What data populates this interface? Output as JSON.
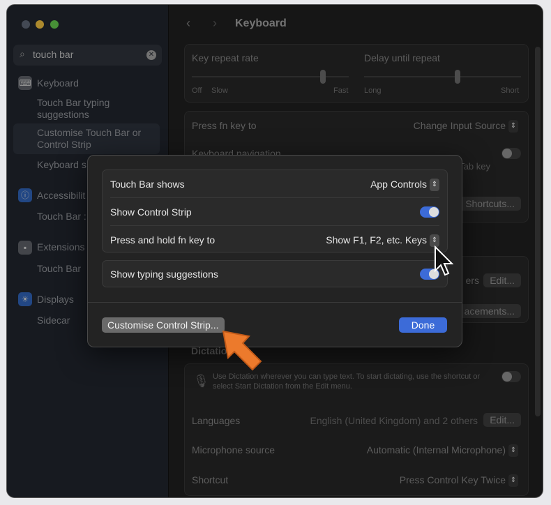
{
  "sidebar": {
    "search_value": "touch bar",
    "groups": [
      {
        "label": "Keyboard",
        "items": [
          "Touch Bar typing suggestions",
          "Customise Touch Bar or Control Strip",
          "Keyboard s"
        ]
      },
      {
        "label": "Accessibilit",
        "items": [
          "Touch Bar :"
        ]
      },
      {
        "label": "Extensions",
        "items": [
          "Touch Bar"
        ]
      },
      {
        "label": "Displays",
        "items": [
          "Sidecar"
        ]
      }
    ]
  },
  "header": {
    "title": "Keyboard"
  },
  "main": {
    "key_repeat": {
      "label": "Key repeat rate",
      "min": "Off",
      "min2": "Slow",
      "max": "Fast",
      "value_fraction": 0.85
    },
    "delay_repeat": {
      "label": "Delay until repeat",
      "min": "Long",
      "max": "Short",
      "value_fraction": 0.6
    },
    "fn_key": {
      "label": "Press fn key to",
      "value": "Change Input Source"
    },
    "keyboard_nav": {
      "label": "Keyboard navigation",
      "hint": "Tab key"
    },
    "shortcuts_btn": "Shortcuts...",
    "edit_btn": "Edit...",
    "edit_hint": "ers",
    "replacements_btn": "acements...",
    "dictation": {
      "heading": "Dictation",
      "desc": "Use Dictation wherever you can type text. To start dictating, use the shortcut or select Start Dictation from the Edit menu.",
      "languages_label": "Languages",
      "languages_value": "English (United Kingdom) and 2 others",
      "languages_btn": "Edit...",
      "mic_label": "Microphone source",
      "mic_value": "Automatic (Internal Microphone)",
      "shortcut_label": "Shortcut",
      "shortcut_value": "Press Control Key Twice"
    }
  },
  "modal": {
    "touch_bar_shows": {
      "label": "Touch Bar shows",
      "value": "App Controls"
    },
    "show_control_strip": {
      "label": "Show Control Strip",
      "on": true
    },
    "press_hold_fn": {
      "label": "Press and hold fn key to",
      "value": "Show F1, F2, etc. Keys"
    },
    "typing_suggestions": {
      "label": "Show typing suggestions",
      "on": true
    },
    "customise_btn": "Customise Control Strip...",
    "done_btn": "Done"
  },
  "colors": {
    "accent": "#3c6bd8",
    "arrow": "#ec7a2c"
  }
}
